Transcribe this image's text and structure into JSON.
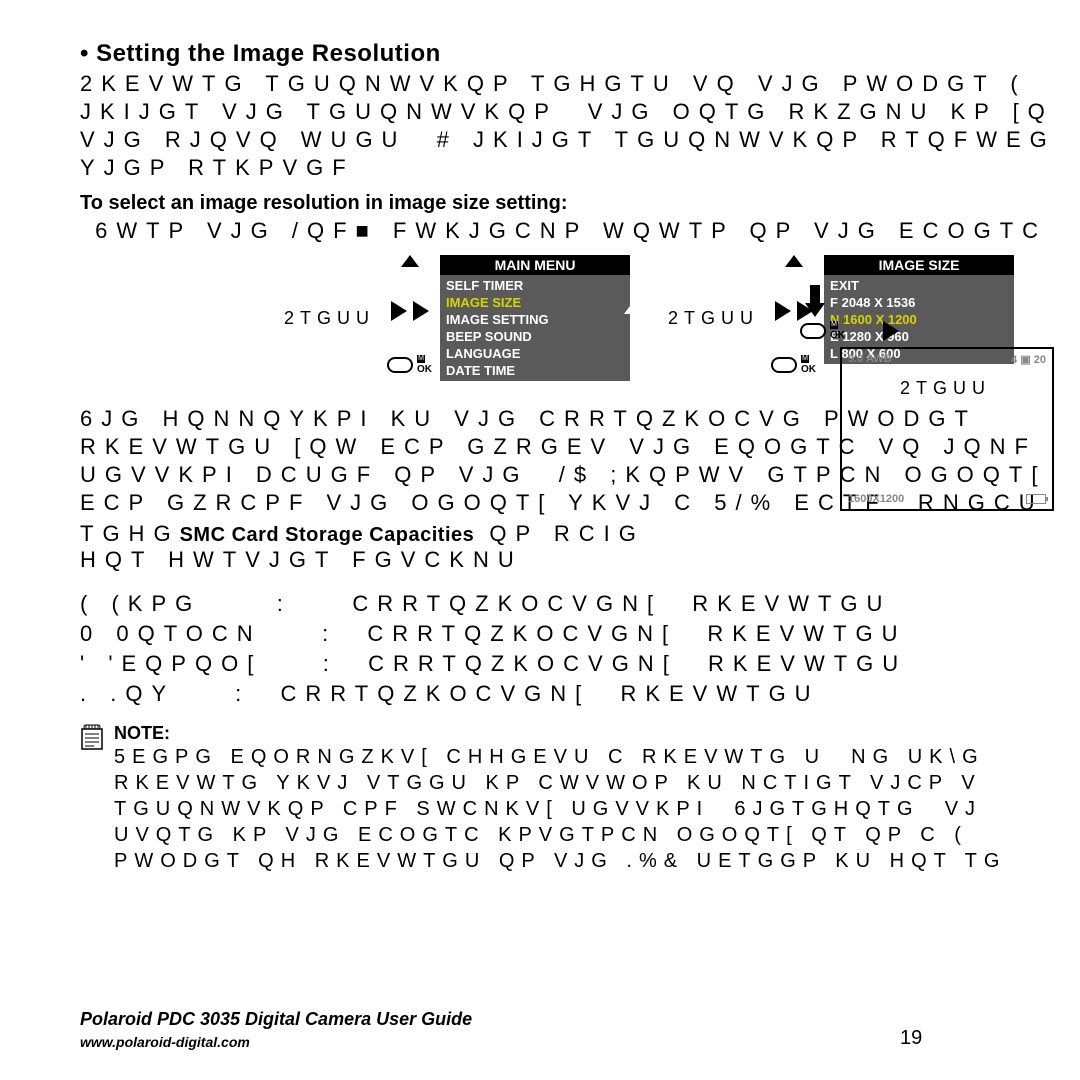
{
  "title": "Setting the Image Resolution",
  "para1": "2KEVWTG TGUQNWVKQP TGHGTU VQ VJG PWODGT (\nJKIJGT VJG TGUQNWVKQP  VJG OQTG RKZGNU KP [Q\nVJG RJQVQ WUGU  # JKIJGT TGUQNWVKQP RTQFWEG\nYJGP RTKPVGF",
  "sub1": "To select an image resolution in image size setting:",
  "line2": " 6WTP VJG /QF■ FWKJGCNP WQWTP QP VJG ECOGTC",
  "press": "2TGUU",
  "main_menu": {
    "title": "MAIN  MENU",
    "items": [
      "SELF TIMER",
      "IMAGE  SIZE",
      "IMAGE  SETTING",
      "BEEP  SOUND",
      "LANGUAGE",
      "DATE  TIME"
    ],
    "highlight_index": 1
  },
  "image_size": {
    "title": "IMAGE SIZE",
    "items": [
      "EXIT",
      "F  2048  X  1536",
      "N  1600  X  1200",
      "E  1280  X  960",
      "L   800  X  600"
    ],
    "highlight_index": 2
  },
  "para2": "6JG HQNNQYKPI KU VJG CRRTQZKOCVG PWODGT\nRKEVWTGU [QW ECP GZRGEV VJG EQOGTC VQ JQNF\nUGVVKPI DCUGF QP VJG  /$ ;KQPWV GTPCN OGOQT[\nECP GZRCPF VJG OGOQT[ YKVJ C 5/% ECTF  RNGCU",
  "bold_mid": "SMC Card Storage Capacities",
  "para2b": " QP RCIG  \nHQT HWTVJGT FGVCKNU",
  "list": "( (KPG     :    CRRTQZKOCVGN[  RKEVWTGU\n0 0QTOCN    :  CRRTQZKOCVGN[  RKEVWTGU\n' 'EQPQO[    :  CRRTQZKOCVGN[  RKEVWTGU\n. .QY    :  CRRTQZKOCVGN[  RKEVWTGU",
  "note_label": "NOTE:",
  "note_body": "5EGPG EQORNGZKV[ CHHGEVU C RKEVWTG U  NG UK\\G\nRKEVWTG YKVJ VTGGU KP CWVWOP KU NCTIGT VJCP V\nTGUQNWVKQP CPF SWCNKV[ UGVVKPI  6JGTGHQTG  VJ\nUVQTG KP VJG ECOGTC KPVGTPCN OGOQT[ QT QP C (\nPWODGT QH RKEVWTGU QP VJG .%& UETGGP KU HQT TG",
  "shot": {
    "tl": "9.0  AWB",
    "tr": "4 ▣  20",
    "bl": "1600X1200"
  },
  "footer_title": "Polaroid PDC 3035 Digital Camera User Guide",
  "footer_url": "www.polaroid-digital.com",
  "page_num": "19",
  "ok": "OK",
  "m": "M"
}
